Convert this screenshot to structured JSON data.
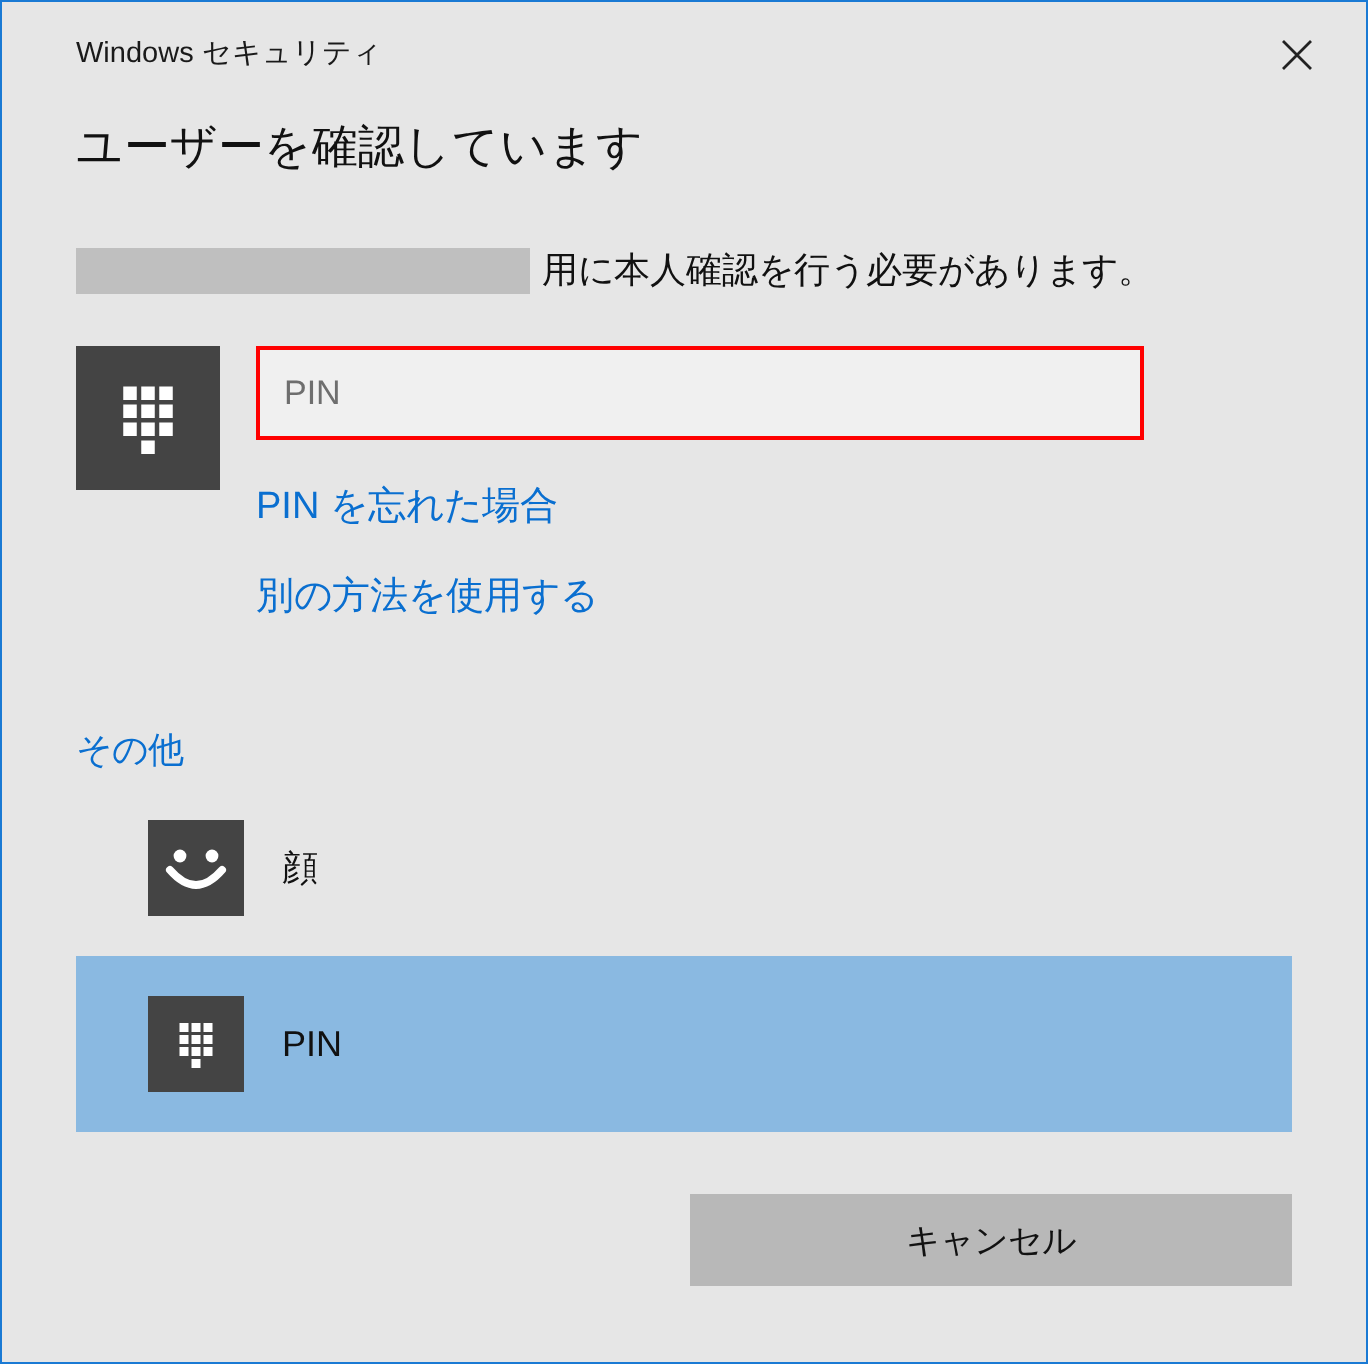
{
  "window": {
    "title": "Windows セキュリティ",
    "heading": "ユーザーを確認しています"
  },
  "prompt": {
    "account_redacted": true,
    "text": "用に本人確認を行う必要があります。"
  },
  "pin_field": {
    "placeholder": "PIN",
    "highlighted": true
  },
  "links": [
    "PIN を忘れた場合",
    "別の方法を使用する"
  ],
  "other_options": {
    "heading": "その他",
    "items": [
      {
        "kind": "face",
        "label": "顔",
        "selected": false
      },
      {
        "kind": "pin",
        "label": "PIN",
        "selected": true
      }
    ]
  },
  "buttons": [
    {
      "label": "キャンセル"
    }
  ]
}
